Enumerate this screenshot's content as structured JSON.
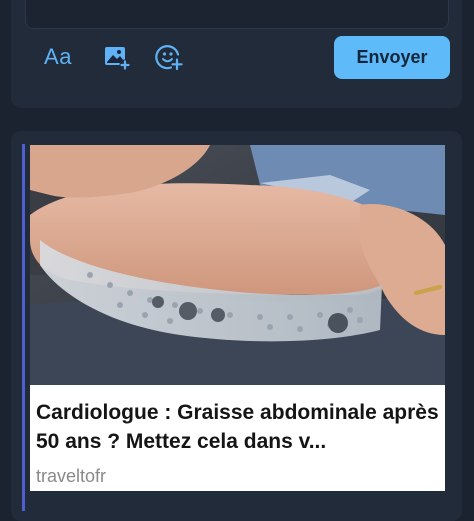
{
  "composer": {
    "text_format_label": "Aa",
    "text_format_icon": "text-format-icon",
    "image_icon": "add-image-icon",
    "emoji_icon": "add-emoji-icon",
    "send_label": "Envoyer",
    "accent_color": "#5ebaf8"
  },
  "ad": {
    "image_icon": "insole-photo",
    "headline": "Cardiologue : Graisse abdominale après 50 ans ? Mettez cela dans v...",
    "source": "traveltofr",
    "accent_color": "#4f5fd0"
  }
}
